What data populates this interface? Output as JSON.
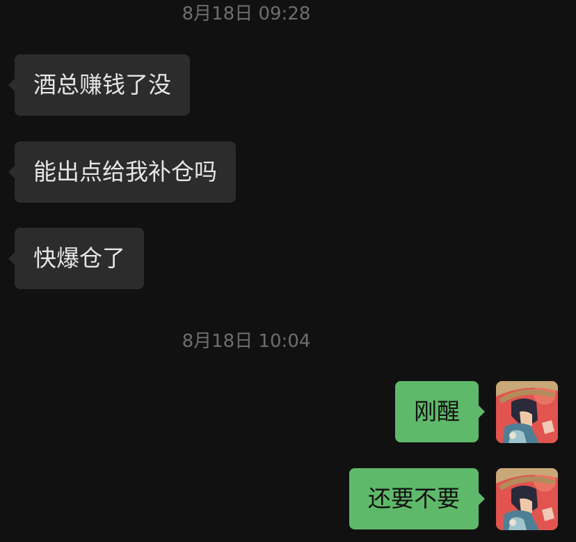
{
  "timestamps": [
    "8月18日 09:28",
    "8月18日 10:04"
  ],
  "messages": [
    {
      "sender": "other",
      "text": "酒总赚钱了没"
    },
    {
      "sender": "other",
      "text": "能出点给我补仓吗"
    },
    {
      "sender": "other",
      "text": "快爆仓了"
    },
    {
      "sender": "self",
      "text": "刚醒"
    },
    {
      "sender": "self",
      "text": "还要不要"
    }
  ],
  "colors": {
    "background": "#111111",
    "incoming_bubble": "#2c2c2c",
    "outgoing_bubble": "#5fb96a",
    "timestamp": "#6e6e6e"
  },
  "icons": {
    "self_avatar": "anime-character-avatar"
  }
}
